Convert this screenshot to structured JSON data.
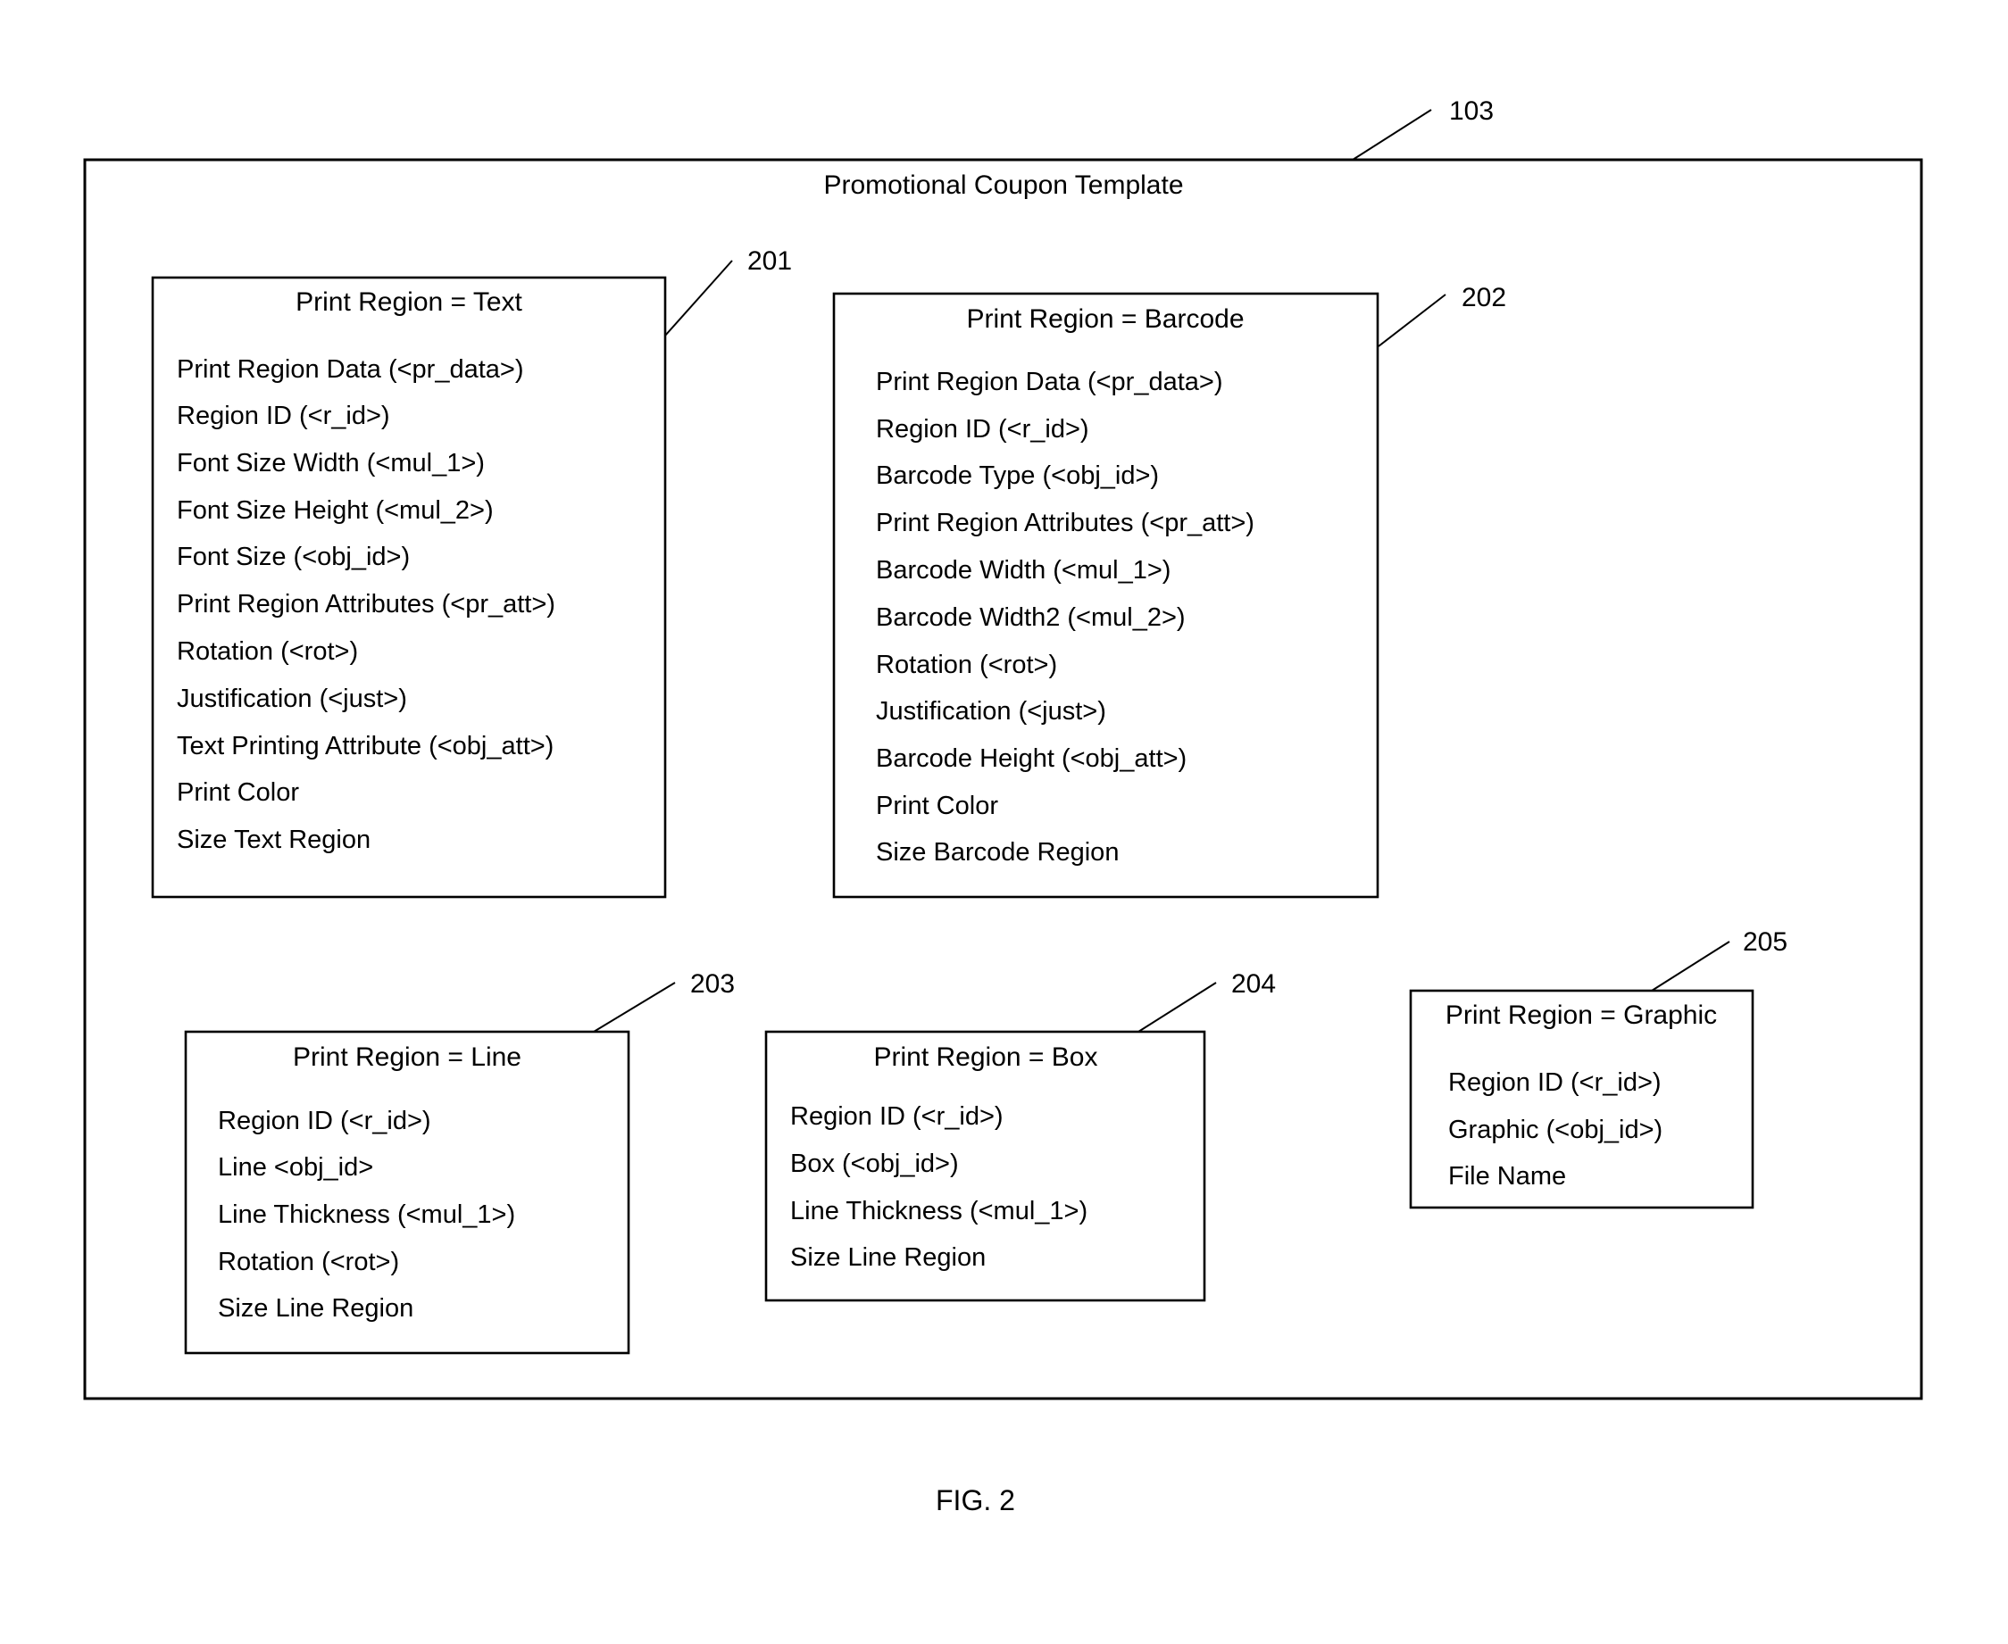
{
  "figure": {
    "caption": "FIG. 2",
    "template": {
      "ref": "103",
      "title": "Promotional Coupon Template"
    },
    "regions": [
      {
        "ref": "201",
        "title": "Print Region = Text",
        "items": [
          "Print Region Data (<pr_data>)",
          "Region ID (<r_id>)",
          "Font Size Width (<mul_1>)",
          "Font Size Height (<mul_2>)",
          "Font Size (<obj_id>)",
          "Print Region Attributes (<pr_att>)",
          "Rotation (<rot>)",
          "Justification (<just>)",
          "Text Printing Attribute (<obj_att>)",
          "Print Color",
          "Size Text Region"
        ]
      },
      {
        "ref": "202",
        "title": "Print Region = Barcode",
        "items": [
          "Print Region Data (<pr_data>)",
          "Region ID (<r_id>)",
          "Barcode Type (<obj_id>)",
          "Print Region Attributes (<pr_att>)",
          "Barcode Width (<mul_1>)",
          "Barcode Width2 (<mul_2>)",
          "Rotation (<rot>)",
          "Justification (<just>)",
          "Barcode Height (<obj_att>)",
          "Print Color",
          "Size Barcode Region"
        ]
      },
      {
        "ref": "203",
        "title": "Print Region = Line",
        "items": [
          "Region ID (<r_id>)",
          "Line <obj_id>",
          "Line Thickness (<mul_1>)",
          "Rotation (<rot>)",
          "Size Line Region"
        ]
      },
      {
        "ref": "204",
        "title": "Print Region = Box",
        "items": [
          "Region ID (<r_id>)",
          "Box (<obj_id>)",
          "Line Thickness (<mul_1>)",
          "Size Line Region"
        ]
      },
      {
        "ref": "205",
        "title": "Print Region = Graphic",
        "items": [
          "Region ID (<r_id>)",
          "Graphic (<obj_id>)",
          "File Name"
        ]
      }
    ]
  }
}
